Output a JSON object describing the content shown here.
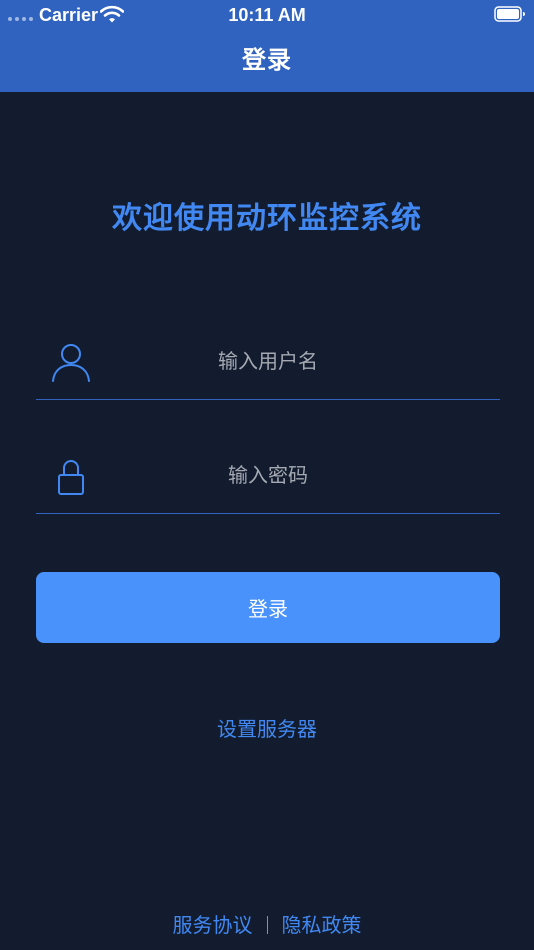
{
  "status_bar": {
    "carrier": "Carrier",
    "time": "10:11 AM",
    "wifi_icon": "wifi-icon",
    "battery_icon": "battery-icon"
  },
  "nav": {
    "title": "登录"
  },
  "welcome_text": "欢迎使用动环监控系统",
  "form": {
    "username": {
      "placeholder": "输入用户名",
      "value": "",
      "icon": "user-icon"
    },
    "password": {
      "placeholder": "输入密码",
      "value": "",
      "icon": "lock-icon"
    },
    "login_label": "登录"
  },
  "server_settings_label": "设置服务器",
  "footer": {
    "service_agreement": "服务协议",
    "privacy_policy": "隐私政策"
  },
  "colors": {
    "header_bg": "#2f63bf",
    "page_bg": "#121c2e",
    "accent": "#4188f2",
    "button_bg": "#4992fb"
  }
}
